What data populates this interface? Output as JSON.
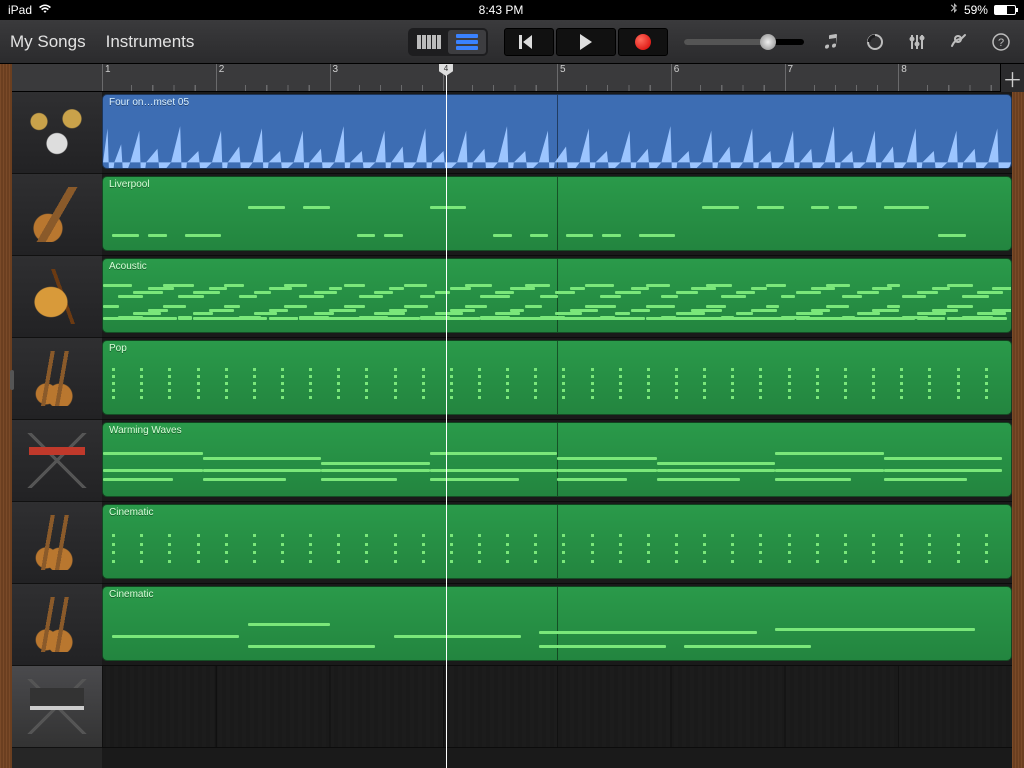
{
  "status": {
    "device": "iPad",
    "time": "8:43 PM",
    "battery": "59%"
  },
  "toolbar": {
    "mySongs": "My Songs",
    "instruments": "Instruments"
  },
  "ruler": {
    "bars": [
      "1",
      "2",
      "3",
      "4",
      "5",
      "6",
      "7",
      "8"
    ],
    "playhead_bar": "4",
    "playhead_pct": 37.8
  },
  "tracks": [
    {
      "instrument": "drums",
      "region": "Four on…mset 05",
      "type": "audio"
    },
    {
      "instrument": "bass",
      "region": "Liverpool",
      "type": "midi"
    },
    {
      "instrument": "guitar",
      "region": "Acoustic",
      "type": "midi"
    },
    {
      "instrument": "strings",
      "region": "Pop",
      "type": "midi"
    },
    {
      "instrument": "keys",
      "region": "Warming Waves",
      "type": "midi"
    },
    {
      "instrument": "strings",
      "region": "Cinematic",
      "type": "midi"
    },
    {
      "instrument": "strings",
      "region": "Cinematic",
      "type": "midi"
    },
    {
      "instrument": "synth",
      "region": null,
      "type": "empty"
    }
  ]
}
